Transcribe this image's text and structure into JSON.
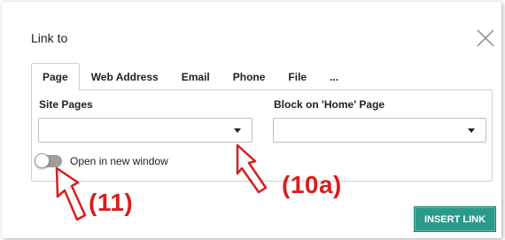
{
  "dialog": {
    "title": "Link to",
    "close_icon": "close-icon"
  },
  "tabs": [
    {
      "label": "Page",
      "active": true
    },
    {
      "label": "Web Address",
      "active": false
    },
    {
      "label": "Email",
      "active": false
    },
    {
      "label": "Phone",
      "active": false
    },
    {
      "label": "File",
      "active": false
    },
    {
      "label": "...",
      "active": false
    }
  ],
  "form": {
    "site_pages_label": "Site Pages",
    "site_pages_value": "",
    "block_label": "Block on 'Home' Page",
    "block_value": "",
    "open_new_window_label": "Open in new window",
    "open_new_window_on": false
  },
  "buttons": {
    "insert_link": "INSERT LINK"
  },
  "annotations": {
    "a10": "(10a)",
    "a11": "(11)"
  },
  "colors": {
    "accent": "#2a9a89",
    "annotation": "#d81e1e"
  }
}
